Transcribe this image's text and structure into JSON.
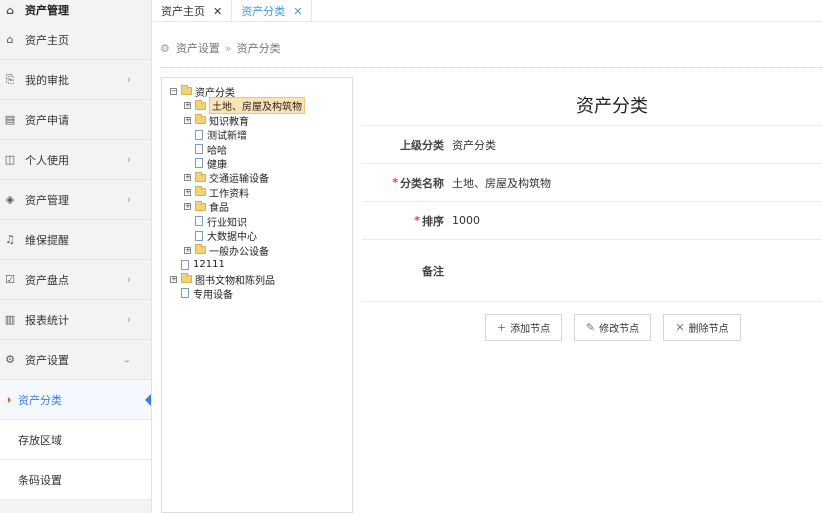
{
  "sidebar": {
    "title": "资产管理",
    "items": [
      {
        "label": "资产主页",
        "icon": "home-icon",
        "arrow": ""
      },
      {
        "label": "我的审批",
        "icon": "approval-icon",
        "arrow": "›"
      },
      {
        "label": "资产申请",
        "icon": "document-icon",
        "arrow": ""
      },
      {
        "label": "个人使用",
        "icon": "user-card-icon",
        "arrow": "›"
      },
      {
        "label": "资产管理",
        "icon": "layers-icon",
        "arrow": "›"
      },
      {
        "label": "维保提醒",
        "icon": "bell-icon",
        "arrow": ""
      },
      {
        "label": "资产盘点",
        "icon": "checklist-icon",
        "arrow": "›"
      },
      {
        "label": "报表统计",
        "icon": "bar-chart-icon",
        "arrow": "›"
      },
      {
        "label": "资产设置",
        "icon": "gear-icon",
        "arrow": "⌄"
      }
    ],
    "subitems": [
      {
        "label": "资产分类",
        "active": true
      },
      {
        "label": "存放区域",
        "active": false
      },
      {
        "label": "条码设置",
        "active": false
      }
    ]
  },
  "tabs": [
    {
      "label": "资产主页",
      "close": "✕"
    },
    {
      "label": "资产分类",
      "close": "✕"
    }
  ],
  "breadcrumb": {
    "parent": "资产设置",
    "sep": "»",
    "current": "资产分类"
  },
  "tree": [
    {
      "label": "资产分类",
      "type": "folder",
      "level": 0,
      "expander": "⊟"
    },
    {
      "label": "土地、房屋及构筑物",
      "type": "folder",
      "level": 1,
      "expander": "⊞",
      "selected": true
    },
    {
      "label": "知识教育",
      "type": "folder",
      "level": 1,
      "expander": "⊞"
    },
    {
      "label": "测试新增",
      "type": "file",
      "level": 1,
      "expander": ""
    },
    {
      "label": "哈哈",
      "type": "file",
      "level": 1,
      "expander": ""
    },
    {
      "label": "健康",
      "type": "file",
      "level": 1,
      "expander": ""
    },
    {
      "label": "交通运输设备",
      "type": "folder",
      "level": 1,
      "expander": "⊞"
    },
    {
      "label": "工作资料",
      "type": "folder",
      "level": 1,
      "expander": "⊞"
    },
    {
      "label": "食品",
      "type": "folder",
      "level": 1,
      "expander": "⊞"
    },
    {
      "label": "行业知识",
      "type": "file",
      "level": 1,
      "expander": ""
    },
    {
      "label": "大数据中心",
      "type": "file",
      "level": 1,
      "expander": ""
    },
    {
      "label": "一般办公设备",
      "type": "folder",
      "level": 1,
      "expander": "⊞"
    },
    {
      "label": "12111",
      "type": "file",
      "level": 0,
      "expander": ""
    },
    {
      "label": "图书文物和陈列品",
      "type": "folder",
      "level": 0,
      "expander": "⊞"
    },
    {
      "label": "专用设备",
      "type": "file",
      "level": 0,
      "expander": ""
    }
  ],
  "form": {
    "title": "资产分类",
    "rows": [
      {
        "label": "上级分类",
        "value": "资产分类",
        "required": false
      },
      {
        "label": "分类名称",
        "value": "土地、房屋及构筑物",
        "required": true
      },
      {
        "label": "排序",
        "value": "1000",
        "required": true
      },
      {
        "label": "备注",
        "value": "",
        "required": false
      }
    ],
    "required_mark": "*"
  },
  "buttons": [
    {
      "label": "添加节点",
      "icon": "plus-icon",
      "glyph": "+"
    },
    {
      "label": "修改节点",
      "icon": "edit-icon",
      "glyph": "✎"
    },
    {
      "label": "删除节点",
      "icon": "close-icon",
      "glyph": "✕"
    }
  ]
}
